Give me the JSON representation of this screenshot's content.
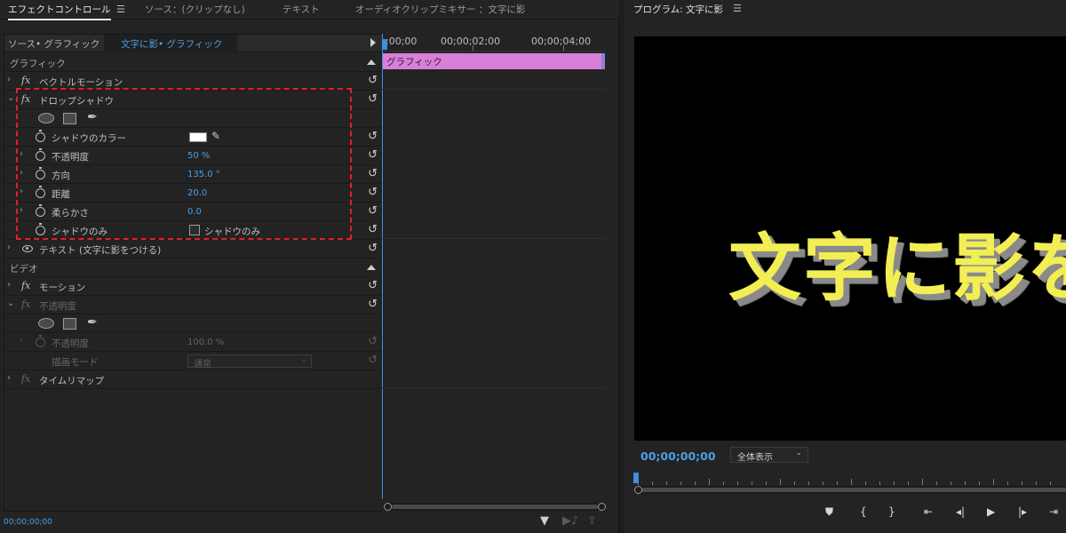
{
  "tabs": [
    {
      "label": "エフェクトコントロール",
      "active": true
    },
    {
      "label": "ソース：(クリップなし)"
    },
    {
      "label": "テキスト"
    },
    {
      "label": "オーディオクリップミキサー ：文字に影"
    }
  ],
  "source_bar": {
    "source_label": "ソース• グラフィック",
    "clip_label": "文字に影• グラフィック"
  },
  "ruler": {
    "t0": ";00;00",
    "t1": "00;00;02;00",
    "t2": "00;00;04;00"
  },
  "timeline_clip_label": "グラフィック",
  "sections": {
    "graphic": "グラフィック",
    "video": "ビデオ"
  },
  "effects": {
    "vector_motion": "ベクトルモーション",
    "drop_shadow": "ドロップシャドウ",
    "shadow_color": "シャドウのカラー",
    "opacity_label": "不透明度",
    "opacity_value": "50 %",
    "direction_label": "方向",
    "direction_value": "135.0 °",
    "distance_label": "距離",
    "distance_value": "20.0",
    "softness_label": "柔らかさ",
    "softness_value": "0.0",
    "shadow_only_label": "シャドウのみ",
    "shadow_only_checkbox": "シャドウのみ",
    "text_layer": "テキスト (文字に影をつける)",
    "motion": "モーション",
    "opacity_fx": "不透明度",
    "opacity_prop": "不透明度",
    "opacity_prop_value": "100.0 %",
    "blend_mode_label": "描画モード",
    "blend_mode_value": "通常",
    "time_remap": "タイムリマップ"
  },
  "bottom_timecode": "00;00;00;00",
  "program": {
    "title": "プログラム: 文字に影",
    "video_text": "文字に影を",
    "timecode": "00;00;00;00",
    "zoom": "全体表示"
  },
  "colors": {
    "accent_blue": "#4a9fe8",
    "clip_pink": "#d97fd9",
    "text_yellow": "#f2ee54",
    "highlight_red": "#e0202a"
  }
}
